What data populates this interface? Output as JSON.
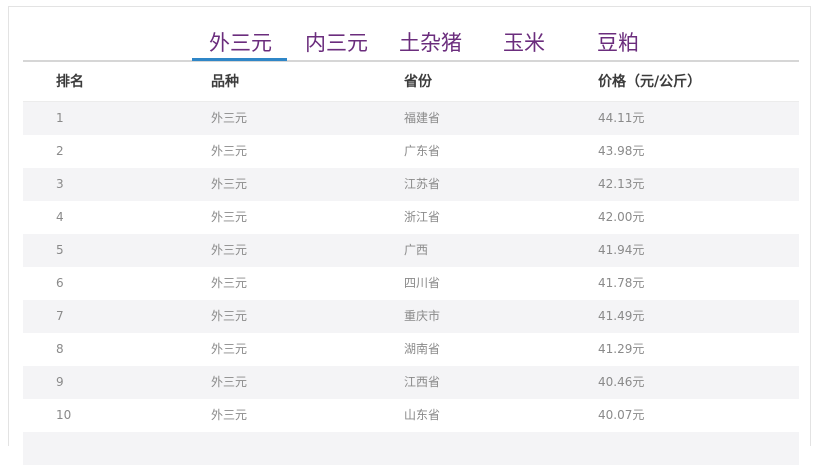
{
  "tabs": [
    {
      "label": "外三元",
      "active": true
    },
    {
      "label": "内三元",
      "active": false
    },
    {
      "label": "土杂猪",
      "active": false
    },
    {
      "label": "玉米",
      "active": false
    },
    {
      "label": "豆粕",
      "active": false
    }
  ],
  "colors": {
    "tab_text": "#6b2d7d",
    "tab_active_underline": "#2f86c7",
    "row_stripe": "#f4f4f6"
  },
  "table": {
    "headers": {
      "rank": "排名",
      "variety": "品种",
      "province": "省份",
      "price": "价格（元/公斤）"
    },
    "rows": [
      {
        "rank": "1",
        "variety": "外三元",
        "province": "福建省",
        "price": "44.11元"
      },
      {
        "rank": "2",
        "variety": "外三元",
        "province": "广东省",
        "price": "43.98元"
      },
      {
        "rank": "3",
        "variety": "外三元",
        "province": "江苏省",
        "price": "42.13元"
      },
      {
        "rank": "4",
        "variety": "外三元",
        "province": "浙江省",
        "price": "42.00元"
      },
      {
        "rank": "5",
        "variety": "外三元",
        "province": "广西",
        "price": "41.94元"
      },
      {
        "rank": "6",
        "variety": "外三元",
        "province": "四川省",
        "price": "41.78元"
      },
      {
        "rank": "7",
        "variety": "外三元",
        "province": "重庆市",
        "price": "41.49元"
      },
      {
        "rank": "8",
        "variety": "外三元",
        "province": "湖南省",
        "price": "41.29元"
      },
      {
        "rank": "9",
        "variety": "外三元",
        "province": "江西省",
        "price": "40.46元"
      },
      {
        "rank": "10",
        "variety": "外三元",
        "province": "山东省",
        "price": "40.07元"
      }
    ]
  }
}
